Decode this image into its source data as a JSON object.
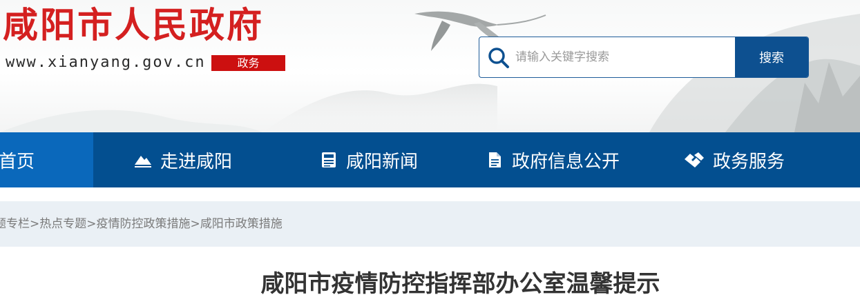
{
  "header": {
    "site_title": "咸阳市人民政府",
    "domain": "www.xianyang.gov.cn",
    "badge": "政务",
    "search": {
      "placeholder": "请输入关键字搜索",
      "value": "",
      "button_label": "搜索",
      "icon": "search-icon"
    },
    "colors": {
      "title": "#d42020",
      "badge": "#cc1010",
      "search_button": "#0d5090"
    }
  },
  "nav": {
    "color": "#034f90",
    "active_color": "#0a68bb",
    "items": [
      {
        "label": "首页",
        "icon": "",
        "active": true
      },
      {
        "label": "走进咸阳",
        "icon": "mountain-icon",
        "active": false
      },
      {
        "label": "咸阳新闻",
        "icon": "newspaper-icon",
        "active": false
      },
      {
        "label": "政府信息公开",
        "icon": "document-icon",
        "active": false
      },
      {
        "label": "政务服务",
        "icon": "handshake-icon",
        "active": false
      }
    ]
  },
  "breadcrumb": {
    "items": [
      "题专栏",
      "热点专题",
      "疫情防控政策措施",
      "咸阳市政策措施"
    ],
    "separator": ">"
  },
  "article": {
    "title": "咸阳市疫情防控指挥部办公室温馨提示"
  }
}
